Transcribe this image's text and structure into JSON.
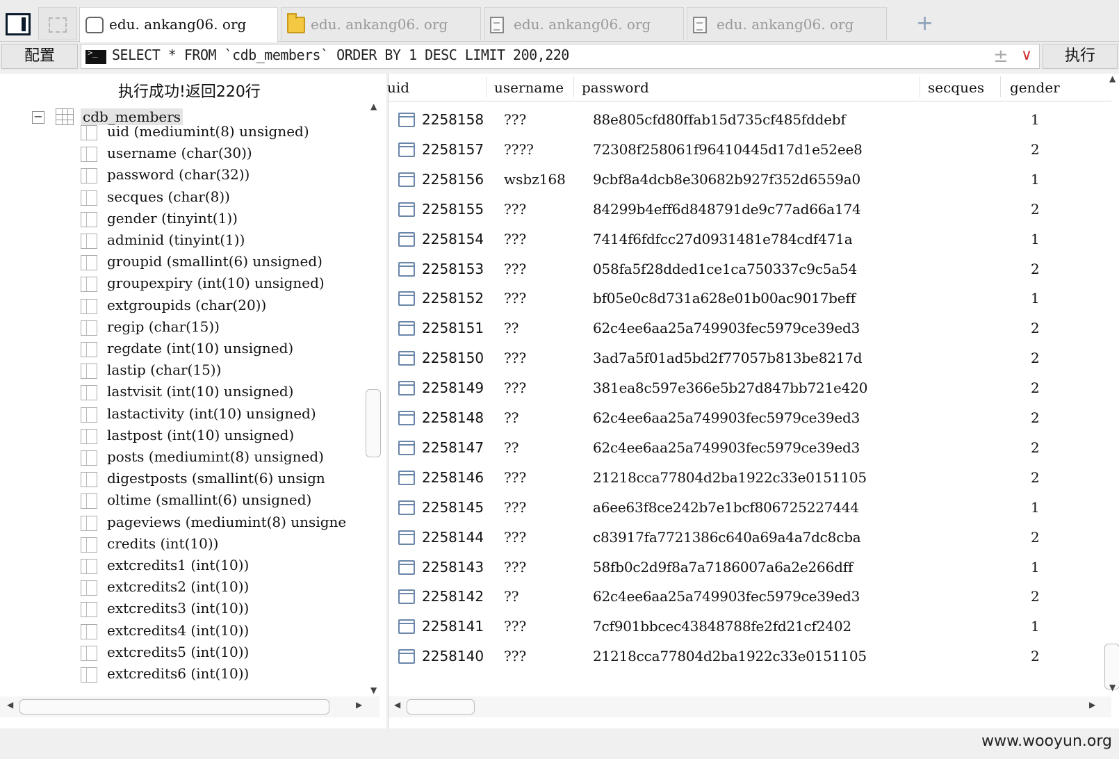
{
  "tabs": [
    {
      "label": "edu. ankang06. org",
      "icon": "database-icon",
      "active": true
    },
    {
      "label": "edu. ankang06. org",
      "icon": "folder-icon",
      "active": false
    },
    {
      "label": "edu. ankang06. org",
      "icon": "file-icon",
      "active": false
    },
    {
      "label": "edu. ankang06. org",
      "icon": "file-icon",
      "active": false
    }
  ],
  "add_tab_label": "+",
  "toolbar": {
    "config_label": "配置",
    "query": "SELECT * FROM `cdb_members` ORDER BY 1 DESC LIMIT 200,220",
    "execute_label": "执行",
    "pm_icon": "±",
    "dropdown_icon": "∨"
  },
  "status": "执行成功!返回220行",
  "tree": {
    "expander": "−",
    "root": "cdb_members",
    "columns": [
      "uid (mediumint(8) unsigned)",
      "username (char(30))",
      "password (char(32))",
      "secques (char(8))",
      "gender (tinyint(1))",
      "adminid (tinyint(1))",
      "groupid (smallint(6) unsigned)",
      "groupexpiry (int(10) unsigned)",
      "extgroupids (char(20))",
      "regip (char(15))",
      "regdate (int(10) unsigned)",
      "lastip (char(15))",
      "lastvisit (int(10) unsigned)",
      "lastactivity (int(10) unsigned)",
      "lastpost (int(10) unsigned)",
      "posts (mediumint(8) unsigned)",
      "digestposts (smallint(6) unsign",
      "oltime (smallint(6) unsigned)",
      "pageviews (mediumint(8) unsigne",
      "credits (int(10))",
      "extcredits1 (int(10))",
      "extcredits2 (int(10))",
      "extcredits3 (int(10))",
      "extcredits4 (int(10))",
      "extcredits5 (int(10))",
      "extcredits6 (int(10))"
    ]
  },
  "grid": {
    "headers": [
      "uid",
      "username",
      "password",
      "secques",
      "gender"
    ],
    "rows": [
      [
        "2258158",
        "???",
        "88e805cfd80ffab15d735cf485fddebf",
        "",
        "1"
      ],
      [
        "2258157",
        "????",
        "72308f258061f96410445d17d1e52ee8",
        "",
        "2"
      ],
      [
        "2258156",
        "wsbz168",
        "9cbf8a4dcb8e30682b927f352d6559a0",
        "",
        "1"
      ],
      [
        "2258155",
        "???",
        "84299b4eff6d848791de9c77ad66a174",
        "",
        "2"
      ],
      [
        "2258154",
        "???",
        "7414f6fdfcc27d0931481e784cdf471a",
        "",
        "1"
      ],
      [
        "2258153",
        "???",
        "058fa5f28dded1ce1ca750337c9c5a54",
        "",
        "2"
      ],
      [
        "2258152",
        "???",
        "bf05e0c8d731a628e01b00ac9017beff",
        "",
        "1"
      ],
      [
        "2258151",
        "??",
        "62c4ee6aa25a749903fec5979ce39ed3",
        "",
        "2"
      ],
      [
        "2258150",
        "???",
        "3ad7a5f01ad5bd2f77057b813be8217d",
        "",
        "2"
      ],
      [
        "2258149",
        "???",
        "381ea8c597e366e5b27d847bb721e420",
        "",
        "2"
      ],
      [
        "2258148",
        "??",
        "62c4ee6aa25a749903fec5979ce39ed3",
        "",
        "2"
      ],
      [
        "2258147",
        "??",
        "62c4ee6aa25a749903fec5979ce39ed3",
        "",
        "2"
      ],
      [
        "2258146",
        "???",
        "21218cca77804d2ba1922c33e0151105",
        "",
        "2"
      ],
      [
        "2258145",
        "???",
        "a6ee63f8ce242b7e1bcf806725227444",
        "",
        "1"
      ],
      [
        "2258144",
        "???",
        "c83917fa7721386c640a69a4a7dc8cba",
        "",
        "2"
      ],
      [
        "2258143",
        "???",
        "58fb0c2d9f8a7a7186007a6a2e266dff",
        "",
        "1"
      ],
      [
        "2258142",
        "??",
        "62c4ee6aa25a749903fec5979ce39ed3",
        "",
        "2"
      ],
      [
        "2258141",
        "???",
        "7cf901bbcec43848788fe2fd21cf2402",
        "",
        "1"
      ],
      [
        "2258140",
        "???",
        "21218cca77804d2ba1922c33e0151105",
        "",
        "2"
      ]
    ]
  },
  "watermark": "www.wooyun.org"
}
